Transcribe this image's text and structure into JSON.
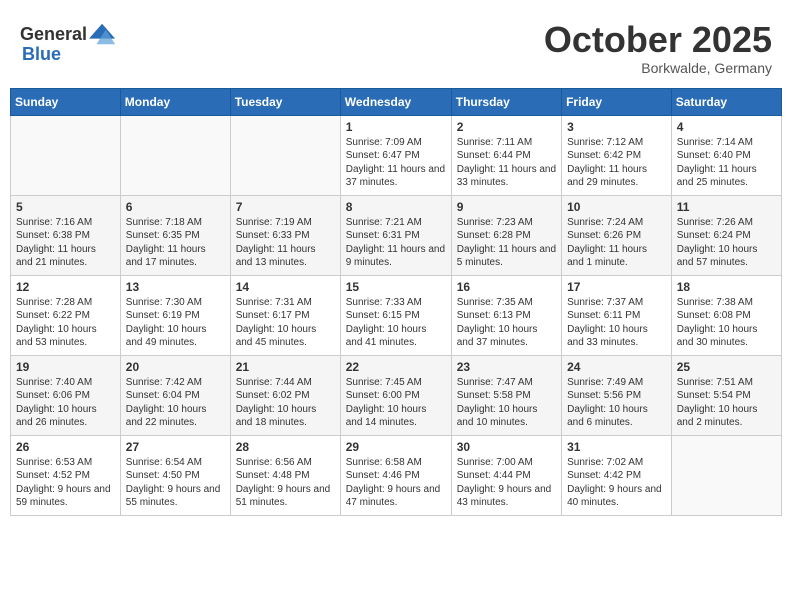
{
  "header": {
    "logo_general": "General",
    "logo_blue": "Blue",
    "month": "October 2025",
    "location": "Borkwalde, Germany"
  },
  "weekdays": [
    "Sunday",
    "Monday",
    "Tuesday",
    "Wednesday",
    "Thursday",
    "Friday",
    "Saturday"
  ],
  "weeks": [
    [
      {
        "day": "",
        "info": ""
      },
      {
        "day": "",
        "info": ""
      },
      {
        "day": "",
        "info": ""
      },
      {
        "day": "1",
        "info": "Sunrise: 7:09 AM\nSunset: 6:47 PM\nDaylight: 11 hours and 37 minutes."
      },
      {
        "day": "2",
        "info": "Sunrise: 7:11 AM\nSunset: 6:44 PM\nDaylight: 11 hours and 33 minutes."
      },
      {
        "day": "3",
        "info": "Sunrise: 7:12 AM\nSunset: 6:42 PM\nDaylight: 11 hours and 29 minutes."
      },
      {
        "day": "4",
        "info": "Sunrise: 7:14 AM\nSunset: 6:40 PM\nDaylight: 11 hours and 25 minutes."
      }
    ],
    [
      {
        "day": "5",
        "info": "Sunrise: 7:16 AM\nSunset: 6:38 PM\nDaylight: 11 hours and 21 minutes."
      },
      {
        "day": "6",
        "info": "Sunrise: 7:18 AM\nSunset: 6:35 PM\nDaylight: 11 hours and 17 minutes."
      },
      {
        "day": "7",
        "info": "Sunrise: 7:19 AM\nSunset: 6:33 PM\nDaylight: 11 hours and 13 minutes."
      },
      {
        "day": "8",
        "info": "Sunrise: 7:21 AM\nSunset: 6:31 PM\nDaylight: 11 hours and 9 minutes."
      },
      {
        "day": "9",
        "info": "Sunrise: 7:23 AM\nSunset: 6:28 PM\nDaylight: 11 hours and 5 minutes."
      },
      {
        "day": "10",
        "info": "Sunrise: 7:24 AM\nSunset: 6:26 PM\nDaylight: 11 hours and 1 minute."
      },
      {
        "day": "11",
        "info": "Sunrise: 7:26 AM\nSunset: 6:24 PM\nDaylight: 10 hours and 57 minutes."
      }
    ],
    [
      {
        "day": "12",
        "info": "Sunrise: 7:28 AM\nSunset: 6:22 PM\nDaylight: 10 hours and 53 minutes."
      },
      {
        "day": "13",
        "info": "Sunrise: 7:30 AM\nSunset: 6:19 PM\nDaylight: 10 hours and 49 minutes."
      },
      {
        "day": "14",
        "info": "Sunrise: 7:31 AM\nSunset: 6:17 PM\nDaylight: 10 hours and 45 minutes."
      },
      {
        "day": "15",
        "info": "Sunrise: 7:33 AM\nSunset: 6:15 PM\nDaylight: 10 hours and 41 minutes."
      },
      {
        "day": "16",
        "info": "Sunrise: 7:35 AM\nSunset: 6:13 PM\nDaylight: 10 hours and 37 minutes."
      },
      {
        "day": "17",
        "info": "Sunrise: 7:37 AM\nSunset: 6:11 PM\nDaylight: 10 hours and 33 minutes."
      },
      {
        "day": "18",
        "info": "Sunrise: 7:38 AM\nSunset: 6:08 PM\nDaylight: 10 hours and 30 minutes."
      }
    ],
    [
      {
        "day": "19",
        "info": "Sunrise: 7:40 AM\nSunset: 6:06 PM\nDaylight: 10 hours and 26 minutes."
      },
      {
        "day": "20",
        "info": "Sunrise: 7:42 AM\nSunset: 6:04 PM\nDaylight: 10 hours and 22 minutes."
      },
      {
        "day": "21",
        "info": "Sunrise: 7:44 AM\nSunset: 6:02 PM\nDaylight: 10 hours and 18 minutes."
      },
      {
        "day": "22",
        "info": "Sunrise: 7:45 AM\nSunset: 6:00 PM\nDaylight: 10 hours and 14 minutes."
      },
      {
        "day": "23",
        "info": "Sunrise: 7:47 AM\nSunset: 5:58 PM\nDaylight: 10 hours and 10 minutes."
      },
      {
        "day": "24",
        "info": "Sunrise: 7:49 AM\nSunset: 5:56 PM\nDaylight: 10 hours and 6 minutes."
      },
      {
        "day": "25",
        "info": "Sunrise: 7:51 AM\nSunset: 5:54 PM\nDaylight: 10 hours and 2 minutes."
      }
    ],
    [
      {
        "day": "26",
        "info": "Sunrise: 6:53 AM\nSunset: 4:52 PM\nDaylight: 9 hours and 59 minutes."
      },
      {
        "day": "27",
        "info": "Sunrise: 6:54 AM\nSunset: 4:50 PM\nDaylight: 9 hours and 55 minutes."
      },
      {
        "day": "28",
        "info": "Sunrise: 6:56 AM\nSunset: 4:48 PM\nDaylight: 9 hours and 51 minutes."
      },
      {
        "day": "29",
        "info": "Sunrise: 6:58 AM\nSunset: 4:46 PM\nDaylight: 9 hours and 47 minutes."
      },
      {
        "day": "30",
        "info": "Sunrise: 7:00 AM\nSunset: 4:44 PM\nDaylight: 9 hours and 43 minutes."
      },
      {
        "day": "31",
        "info": "Sunrise: 7:02 AM\nSunset: 4:42 PM\nDaylight: 9 hours and 40 minutes."
      },
      {
        "day": "",
        "info": ""
      }
    ]
  ]
}
